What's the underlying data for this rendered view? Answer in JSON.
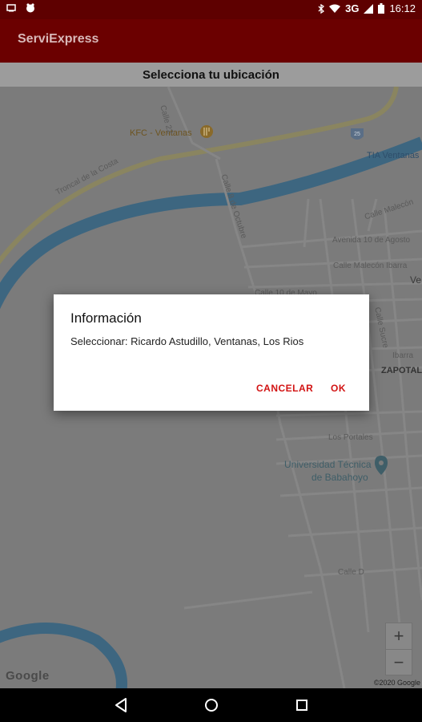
{
  "status_bar": {
    "network": "3G",
    "time": "16:12"
  },
  "app_bar": {
    "title": "ServiExpress"
  },
  "subheader": {
    "text": "Selecciona tu ubicación"
  },
  "map": {
    "labels": {
      "kfc": "KFC - Ventanas",
      "tia": "TIA Ventanas",
      "troncal": "Troncal de la Costa",
      "calle22": "Calle 22",
      "calle_bolivar": "Calle 8 de Octubre",
      "calle_malecon": "Calle Malecón",
      "avenida_10_agosto": "Avenida 10 de Agosto",
      "calle_malecon_ibarra": "Calle Malecón Ibarra",
      "calle_10_mayo": "Calle 10 de Mayo",
      "calle_sucre": "Calle Sucre",
      "ve": "Ve",
      "ibarra": "Ibarra",
      "zapotal": "ZAPOTAL",
      "los_portales": "Los Portales",
      "universidad_line1": "Universidad Técnica",
      "universidad_line2": "de Babahoyo",
      "calle_d": "Calle D",
      "highway_shield": "25"
    },
    "zoom_in": "+",
    "zoom_out": "−",
    "google_logo": "Google",
    "copyright": "©2020 Google"
  },
  "dialog": {
    "title": "Información",
    "message": "Seleccionar: Ricardo Astudillo, Ventanas, Los Rios",
    "cancel_label": "CANCELAR",
    "ok_label": "OK"
  },
  "colors": {
    "status_bar": "#5e0000",
    "app_bar": "#6b0000",
    "dialog_button": "#d21313",
    "map_water": "#3d6680",
    "map_road_major": "#8a8560"
  }
}
